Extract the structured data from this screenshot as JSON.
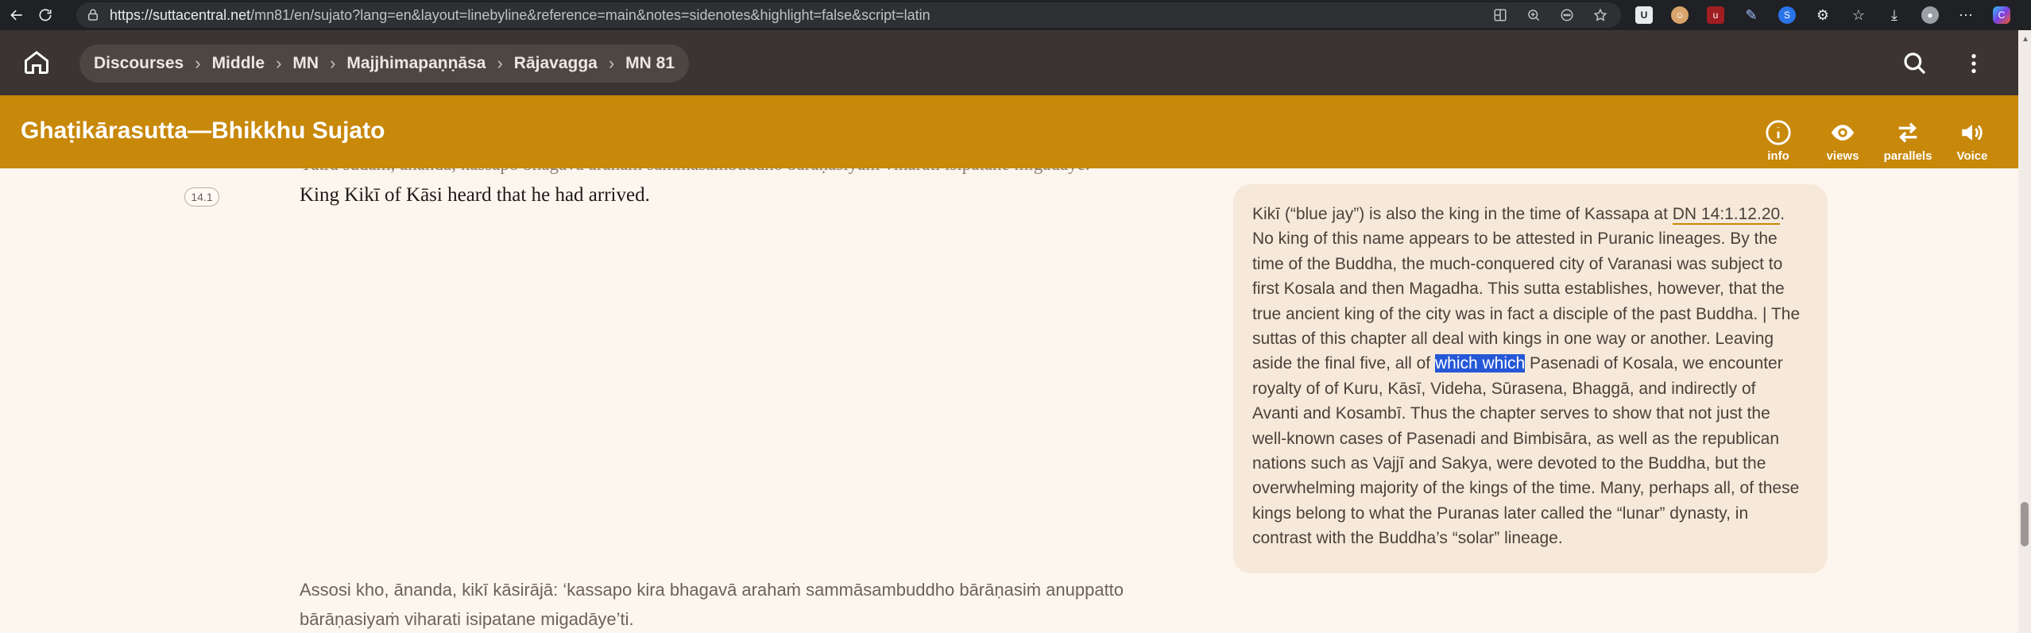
{
  "browser": {
    "url_host": "https://suttacentral.net",
    "url_path": "/mn81/en/sujato?lang=en&layout=linebyline&reference=main&notes=sidenotes&highlight=false&script=latin"
  },
  "site": {
    "breadcrumbs": [
      "Discourses",
      "Middle",
      "MN",
      "Majjhimapaṇṇāsa",
      "Rājavagga",
      "MN 81"
    ]
  },
  "header": {
    "title": "Ghaṭikārasutta—Bhikkhu Sujato",
    "tools": [
      {
        "label": "info",
        "icon": "info-icon"
      },
      {
        "label": "views",
        "icon": "eye-icon"
      },
      {
        "label": "parallels",
        "icon": "parallels-icon"
      },
      {
        "label": "Voice",
        "icon": "speaker-icon"
      }
    ]
  },
  "content": {
    "cut_line": "Yatra sudaṁ, ānanda, kassapo bhagavā arahaṁ sammāsambuddho bārāṇasiyaṁ viharati isipatane migadāye.",
    "segment_ref": "14.1",
    "english": "King Kikī of Kāsi heard that he had arrived.",
    "pali_1": "Assosi kho, ānanda, kikī kāsirājā: ‘kassapo kira bhagavā arahaṁ sammāsambuddho bārāṇasiṁ anuppatto",
    "pali_2": "bārāṇasiyaṁ viharati isipatane migadāye’ti.",
    "note": {
      "part1": "Kikī (“blue jay”) is also the king in the time of Kassapa at ",
      "link": "DN 14:1.12.20",
      "part2": ". No king of this name appears to be attested in Puranic lineages. By the time of the Buddha, the much-conquered city of Varanasi was subject to first Kosala and then Magadha. This sutta establishes, however, that the true ancient king of the city was in fact a disciple of the past Buddha. | The suttas of this chapter all deal with kings in one way or another. Leaving aside the final five, all of ",
      "highlight": "which which",
      "part3": " Pasenadi of Kosala, we encounter royalty of of Kuru, Kāsī, Videha, Sūrasena, Bhaggā, and indirectly of Avanti and Kosambī. Thus the chapter serves to show that not just the well-known cases of Pasenadi and Bimbisāra, as well as the republican nations such as Vajjī and Sakya, were devoted to the Buddha, but the overwhelming majority of the kings of the time. Many, perhaps all, of these kings belong to what the Puranas later called the “lunar” dynasty, in contrast with the Buddha’s “solar” lineage."
    }
  }
}
